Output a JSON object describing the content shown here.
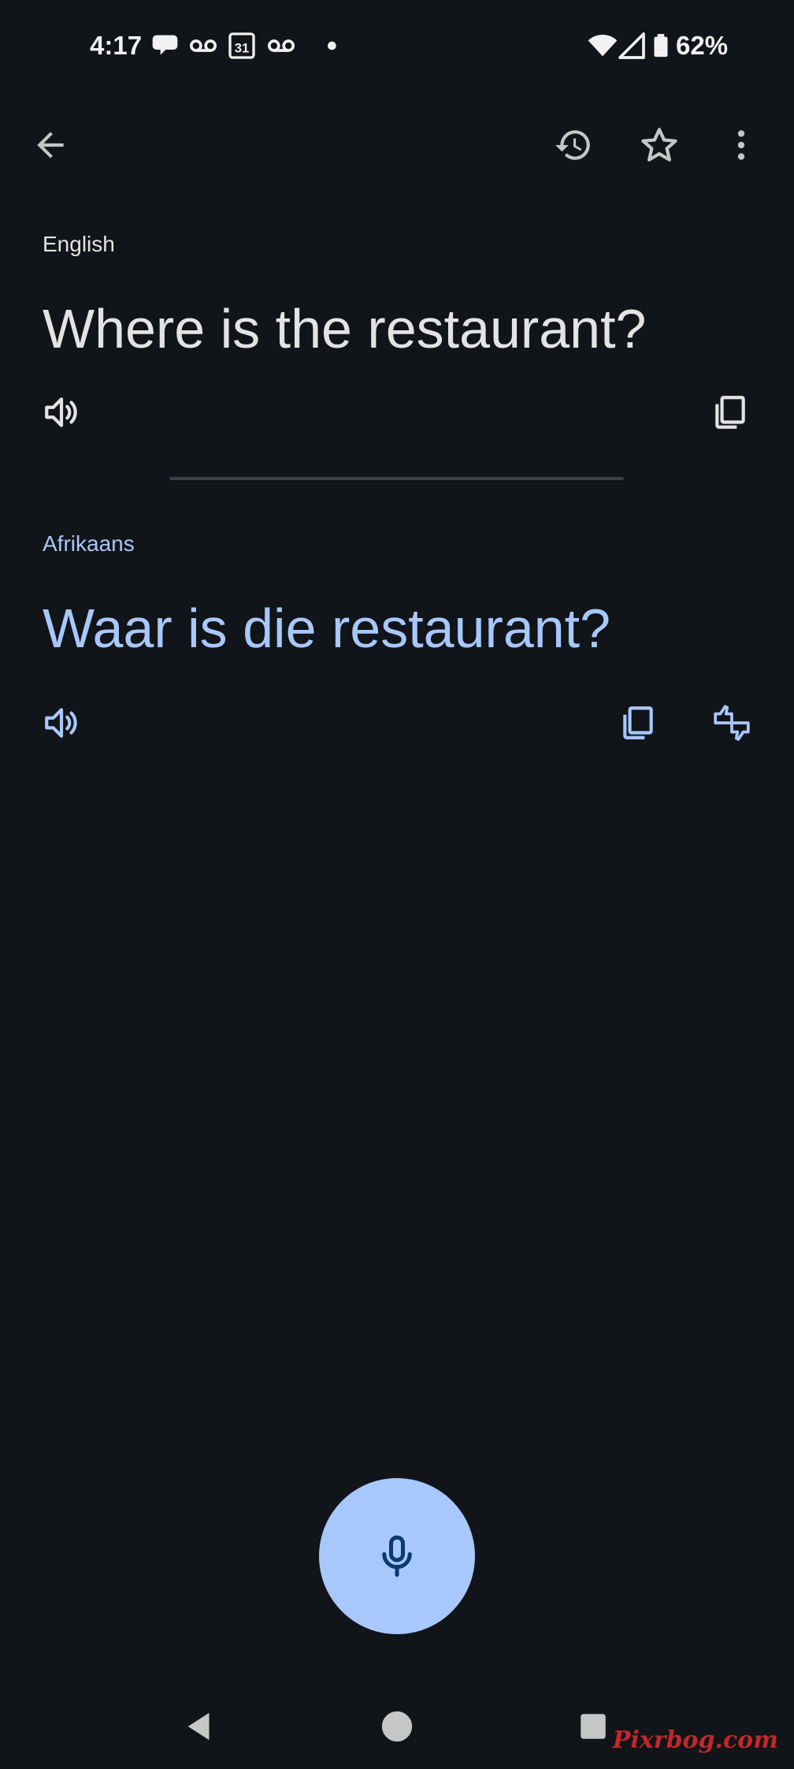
{
  "status_bar": {
    "time": "4:17",
    "icons": [
      "chat-bubble-icon",
      "voicemail-icon",
      "calendar-icon",
      "voicemail-icon",
      "dot-icon"
    ],
    "calendar_day": "31",
    "battery_percent": "62%",
    "right_icons": [
      "wifi-icon",
      "cell-signal-icon",
      "battery-icon"
    ]
  },
  "toolbar": {
    "icons": [
      "back-arrow-icon",
      "history-icon",
      "star-icon",
      "more-vert-icon"
    ]
  },
  "source": {
    "language": "English",
    "text": "Where is the restaurant?",
    "actions": [
      "speaker-icon",
      "copy-icon"
    ]
  },
  "target": {
    "language": "Afrikaans",
    "text": "Waar is die restaurant?",
    "actions": [
      "speaker-icon",
      "copy-icon",
      "feedback-thumbs-icon"
    ]
  },
  "mic": {
    "icon": "microphone-icon"
  },
  "nav_bar": {
    "icons": [
      "nav-back-icon",
      "nav-home-icon",
      "nav-recents-icon"
    ]
  },
  "watermark": {
    "text": "Pixrbog.com"
  },
  "colors": {
    "background": "#111418",
    "primary_text": "#e3e3e3",
    "accent": "#a8c7fa",
    "mic_icon": "#0b3a6e",
    "divider": "#3a4149",
    "watermark": "#c0282a"
  }
}
